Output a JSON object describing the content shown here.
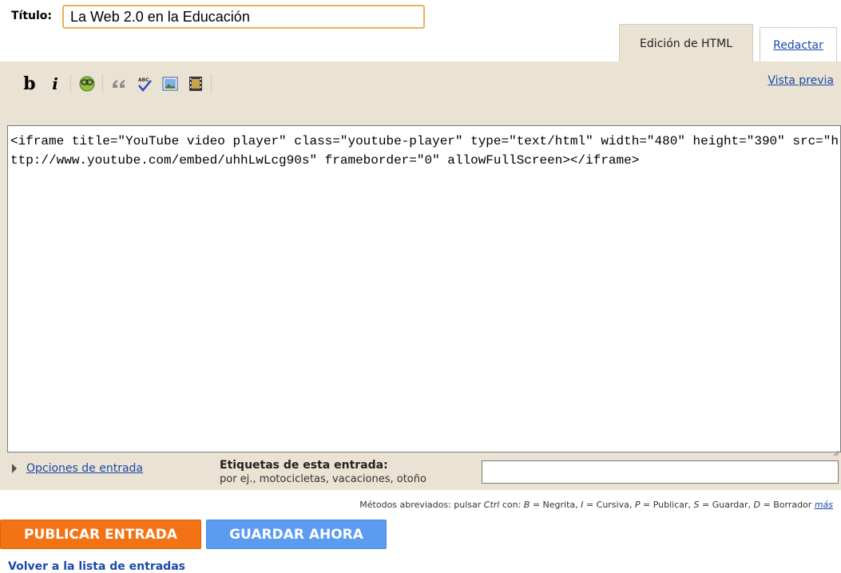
{
  "post": {
    "title_label": "Título:",
    "title_value": "La Web 2.0 en la Educación"
  },
  "tabs": {
    "html_label": "Edición de HTML",
    "compose_label": "Redactar"
  },
  "toolbar": {
    "bold_label": "b",
    "italic_label": "i",
    "icons": [
      "link-icon",
      "quote-icon",
      "spellcheck-icon",
      "image-icon",
      "video-icon"
    ],
    "preview_label": "Vista previa"
  },
  "editor": {
    "content": "<iframe title=\"YouTube video player\" class=\"youtube-player\" type=\"text/html\" width=\"480\" height=\"390\" src=\"http://www.youtube.com/embed/uhhLwLcg90s\" frameborder=\"0\" allowFullScreen></iframe>"
  },
  "post_options": {
    "label": "Opciones de entrada"
  },
  "labels": {
    "title": "Etiquetas de esta entrada:",
    "hint": "por ej., motocicletas, vacaciones, otoño",
    "value": ""
  },
  "shortcuts": {
    "prefix": "Métodos abreviados: pulsar ",
    "ctrl": "Ctrl",
    "with": " con: ",
    "b_key": "B",
    "b_text": " = Negrita, ",
    "i_key": "I",
    "i_text": " = Cursiva, ",
    "p_key": "P",
    "p_text": " = Publicar, ",
    "s_key": "S",
    "s_text": " = Guardar, ",
    "d_key": "D",
    "d_text": " = Borrador ",
    "more": "más"
  },
  "actions": {
    "publish_label": "PUBLICAR ENTRADA",
    "save_label": "GUARDAR AHORA",
    "back_label": "Volver a la lista de entradas"
  },
  "colors": {
    "publish": "#f37314",
    "save": "#5b9bf0",
    "panel": "#eae2d2",
    "link": "#1a4aaa"
  }
}
